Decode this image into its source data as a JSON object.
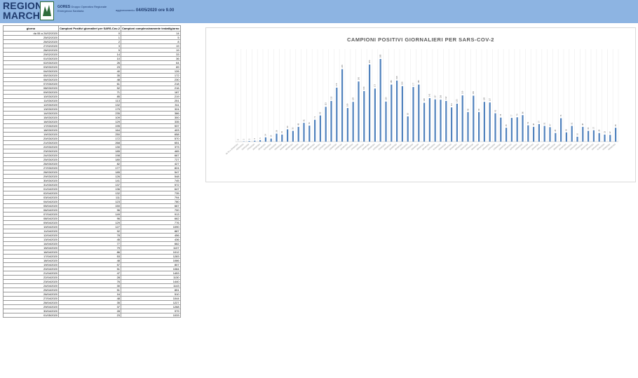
{
  "header": {
    "logo_line1": "REGIONE",
    "logo_line2": "MARCHE",
    "org_name": "GORES",
    "org_desc1": "Gruppo Operativo Regionale",
    "org_desc2": "Emergenza Sanitaria",
    "update_label": "aggiornamento:",
    "update_value": "04/05/2020 ore 9.00"
  },
  "table": {
    "headers": [
      "giorno",
      "Campioni Positivi giornalieri per SARS-Cov-2",
      "Campioni complessivamente testati/giorno"
    ],
    "rows": [
      [
        "da 06 a 24/02/2020",
        "0",
        "14"
      ],
      [
        "25/02/2020",
        "1",
        "5"
      ],
      [
        "26/02/2020",
        "2",
        "8"
      ],
      [
        "27/02/2020",
        "3",
        "19"
      ],
      [
        "28/02/2020",
        "5",
        "19"
      ],
      [
        "29/02/2020",
        "14",
        "33"
      ],
      [
        "01/03/2020",
        "10",
        "36"
      ],
      [
        "02/03/2020",
        "26",
        "64"
      ],
      [
        "03/03/2020",
        "23",
        "89"
      ],
      [
        "04/03/2020",
        "40",
        "126"
      ],
      [
        "05/03/2020",
        "35",
        "172"
      ],
      [
        "06/03/2020",
        "48",
        "230"
      ],
      [
        "07/03/2020",
        "61",
        "218"
      ],
      [
        "08/03/2020",
        "52",
        "216"
      ],
      [
        "09/03/2020",
        "71",
        "187"
      ],
      [
        "10/03/2020",
        "85",
        "219"
      ],
      [
        "11/03/2020",
        "113",
        "251"
      ],
      [
        "12/03/2020",
        "132",
        "311"
      ],
      [
        "13/03/2020",
        "175",
        "324"
      ],
      [
        "14/03/2020",
        "235",
        "386"
      ],
      [
        "15/03/2020",
        "109",
        "300"
      ],
      [
        "16/03/2020",
        "129",
        "335"
      ],
      [
        "17/03/2020",
        "195",
        "537"
      ],
      [
        "18/03/2020",
        "164",
        "403"
      ],
      [
        "19/03/2020",
        "250",
        "658"
      ],
      [
        "20/03/2020",
        "172",
        "570"
      ],
      [
        "21/03/2020",
        "268",
        "651"
      ],
      [
        "22/03/2020",
        "130",
        "373"
      ],
      [
        "23/03/2020",
        "185",
        "465"
      ],
      [
        "24/03/2020",
        "198",
        "667"
      ],
      [
        "25/03/2020",
        "180",
        "727"
      ],
      [
        "26/03/2020",
        "82",
        "427"
      ],
      [
        "27/03/2020",
        "177",
        "824"
      ],
      [
        "28/03/2020",
        "185",
        "547"
      ],
      [
        "29/03/2020",
        "126",
        "548"
      ],
      [
        "30/03/2020",
        "141",
        "745"
      ],
      [
        "31/03/2020",
        "137",
        "572"
      ],
      [
        "01/04/2020",
        "136",
        "647"
      ],
      [
        "02/04/2020",
        "132",
        "735"
      ],
      [
        "03/04/2020",
        "111",
        "794"
      ],
      [
        "04/04/2020",
        "123",
        "780"
      ],
      [
        "05/04/2020",
        "150",
        "667"
      ],
      [
        "06/04/2020",
        "96",
        "700"
      ],
      [
        "07/04/2020",
        "149",
        "913"
      ],
      [
        "08/04/2020",
        "96",
        "662"
      ],
      [
        "09/04/2020",
        "129",
        "776"
      ],
      [
        "10/04/2020",
        "127",
        "1090"
      ],
      [
        "11/04/2020",
        "92",
        "887"
      ],
      [
        "12/04/2020",
        "78",
        "456"
      ],
      [
        "13/04/2020",
        "45",
        "436"
      ],
      [
        "14/04/2020",
        "77",
        "662"
      ],
      [
        "15/04/2020",
        "79",
        "1107"
      ],
      [
        "16/04/2020",
        "86",
        "1012"
      ],
      [
        "17/04/2020",
        "53",
        "1283"
      ],
      [
        "18/04/2020",
        "48",
        "1086"
      ],
      [
        "19/04/2020",
        "57",
        "807"
      ],
      [
        "20/04/2020",
        "51",
        "1084"
      ],
      [
        "21/04/2020",
        "47",
        "1453"
      ],
      [
        "22/04/2020",
        "28",
        "1130"
      ],
      [
        "23/04/2020",
        "76",
        "1440"
      ],
      [
        "24/04/2020",
        "30",
        "1143"
      ],
      [
        "25/04/2020",
        "51",
        "851"
      ],
      [
        "26/04/2020",
        "16",
        "510"
      ],
      [
        "27/04/2020",
        "48",
        "1044"
      ],
      [
        "28/04/2020",
        "35",
        "1227"
      ],
      [
        "29/04/2020",
        "37",
        "1268"
      ],
      [
        "30/04/2020",
        "28",
        "979"
      ],
      [
        "01/05/2020",
        "23",
        "1033"
      ]
    ]
  },
  "chart_data": {
    "type": "bar",
    "title": "CAMPIONI POSITIVI GIORNALIERI PER SARS-COV-2",
    "xlabel": "",
    "ylabel": "",
    "grid": true,
    "bar_color": "#4f81bd",
    "categories": [
      "da 06 a 24/02/2020",
      "25/02/2020",
      "26/02/2020",
      "27/02/2020",
      "28/02/2020",
      "29/02/2020",
      "01/03/2020",
      "02/03/2020",
      "03/03/2020",
      "04/03/2020",
      "05/03/2020",
      "06/03/2020",
      "07/03/2020",
      "08/03/2020",
      "09/03/2020",
      "10/03/2020",
      "11/03/2020",
      "12/03/2020",
      "13/03/2020",
      "14/03/2020",
      "15/03/2020",
      "16/03/2020",
      "17/03/2020",
      "18/03/2020",
      "19/03/2020",
      "20/03/2020",
      "21/03/2020",
      "22/03/2020",
      "23/03/2020",
      "24/03/2020",
      "25/03/2020",
      "26/03/2020",
      "27/03/2020",
      "28/03/2020",
      "29/03/2020",
      "30/03/2020",
      "31/03/2020",
      "01/04/2020",
      "02/04/2020",
      "03/04/2020",
      "04/04/2020",
      "05/04/2020",
      "06/04/2020",
      "07/04/2020",
      "08/04/2020",
      "09/04/2020",
      "10/04/2020",
      "11/04/2020",
      "12/04/2020",
      "13/04/2020",
      "14/04/2020",
      "15/04/2020",
      "16/04/2020",
      "17/04/2020",
      "18/04/2020",
      "19/04/2020",
      "20/04/2020",
      "21/04/2020",
      "22/04/2020",
      "23/04/2020",
      "24/04/2020",
      "25/04/2020",
      "26/04/2020",
      "27/04/2020",
      "28/04/2020",
      "29/04/2020",
      "30/04/2020",
      "01/05/2020",
      "02/05/2020",
      "03/05/2020"
    ],
    "values": [
      0,
      1,
      2,
      3,
      5,
      14,
      10,
      26,
      23,
      40,
      35,
      48,
      61,
      52,
      71,
      85,
      113,
      132,
      175,
      235,
      109,
      129,
      195,
      164,
      250,
      172,
      268,
      130,
      185,
      198,
      180,
      82,
      177,
      185,
      126,
      141,
      137,
      136,
      132,
      111,
      123,
      150,
      96,
      149,
      96,
      129,
      127,
      92,
      78,
      45,
      77,
      79,
      86,
      53,
      48,
      57,
      51,
      47,
      28,
      76,
      30,
      51,
      16,
      48,
      35,
      37,
      28,
      23,
      22,
      45
    ],
    "ylim": [
      0,
      300
    ]
  }
}
